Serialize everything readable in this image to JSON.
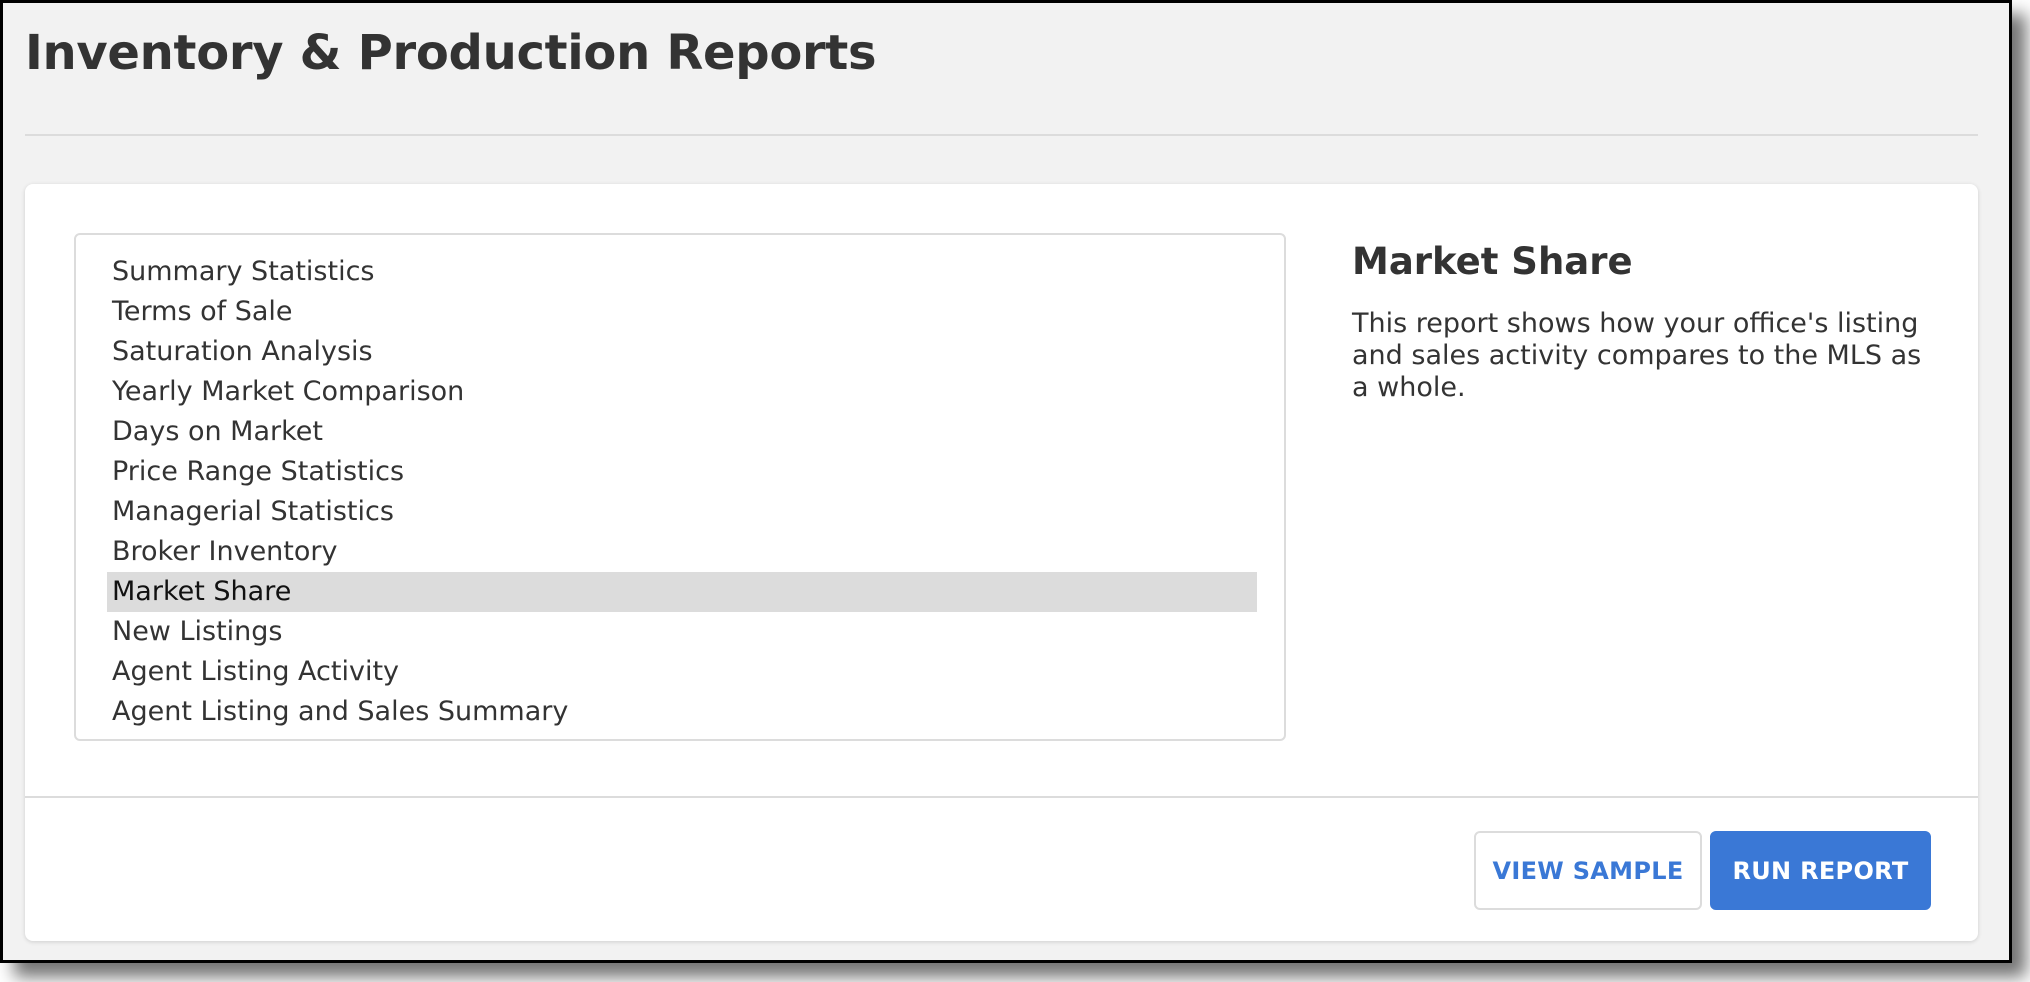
{
  "header": {
    "title": "Inventory & Production Reports"
  },
  "reports": {
    "selected_index": 8,
    "items": [
      {
        "label": "Summary Statistics"
      },
      {
        "label": "Terms of Sale"
      },
      {
        "label": "Saturation Analysis"
      },
      {
        "label": "Yearly Market Comparison"
      },
      {
        "label": "Days on Market"
      },
      {
        "label": "Price Range Statistics"
      },
      {
        "label": "Managerial Statistics"
      },
      {
        "label": "Broker Inventory"
      },
      {
        "label": "Market Share"
      },
      {
        "label": "New Listings"
      },
      {
        "label": "Agent Listing Activity"
      },
      {
        "label": "Agent Listing and Sales Summary"
      }
    ]
  },
  "detail": {
    "title": "Market Share",
    "description": "This report shows how your office's listing and sales activity compares to the MLS as a whole."
  },
  "footer": {
    "view_sample_label": "VIEW SAMPLE",
    "run_report_label": "RUN REPORT"
  },
  "colors": {
    "accent": "#3a78d6",
    "selected_row": "#dcdcdc",
    "page_background": "#f2f2f2"
  }
}
